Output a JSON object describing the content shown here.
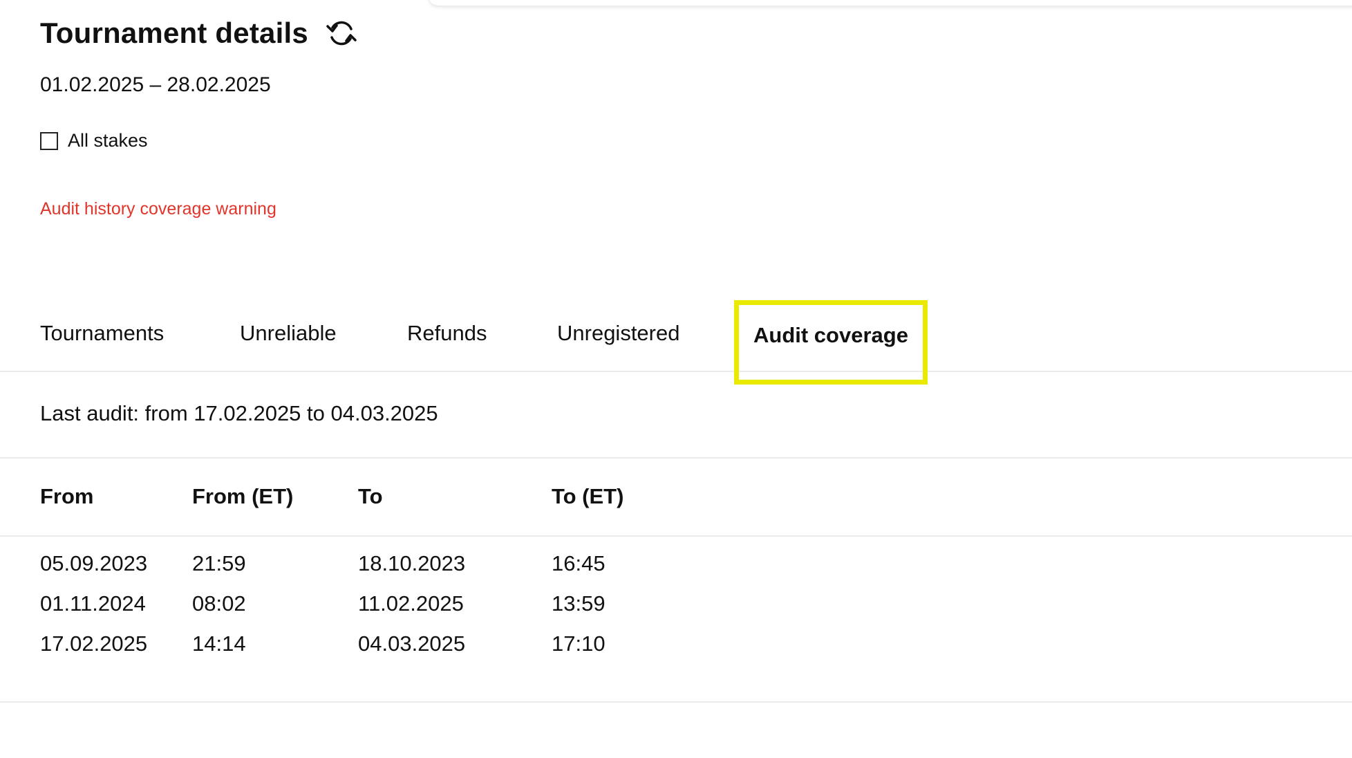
{
  "header": {
    "title": "Tournament details",
    "date_range": "01.02.2025 – 28.02.2025"
  },
  "filters": {
    "all_stakes_label": "All stakes",
    "all_stakes_checked": false
  },
  "warning": {
    "text": "Audit history coverage warning",
    "color": "#e0352b"
  },
  "tabs": [
    {
      "label": "Tournaments",
      "active": false
    },
    {
      "label": "Unreliable",
      "active": false
    },
    {
      "label": "Refunds",
      "active": false
    },
    {
      "label": "Unregistered",
      "active": false
    },
    {
      "label": "Audit coverage",
      "active": true
    }
  ],
  "highlight_color": "#eaea00",
  "audit": {
    "last_audit": "Last audit: from 17.02.2025 to 04.03.2025",
    "columns": [
      "From",
      "From (ET)",
      "To",
      "To (ET)"
    ],
    "rows": [
      [
        "05.09.2023",
        "21:59",
        "18.10.2023",
        "16:45"
      ],
      [
        "01.11.2024",
        "08:02",
        "11.02.2025",
        "13:59"
      ],
      [
        "17.02.2025",
        "14:14",
        "04.03.2025",
        "17:10"
      ]
    ]
  },
  "icons": {
    "refresh": "refresh-icon"
  }
}
